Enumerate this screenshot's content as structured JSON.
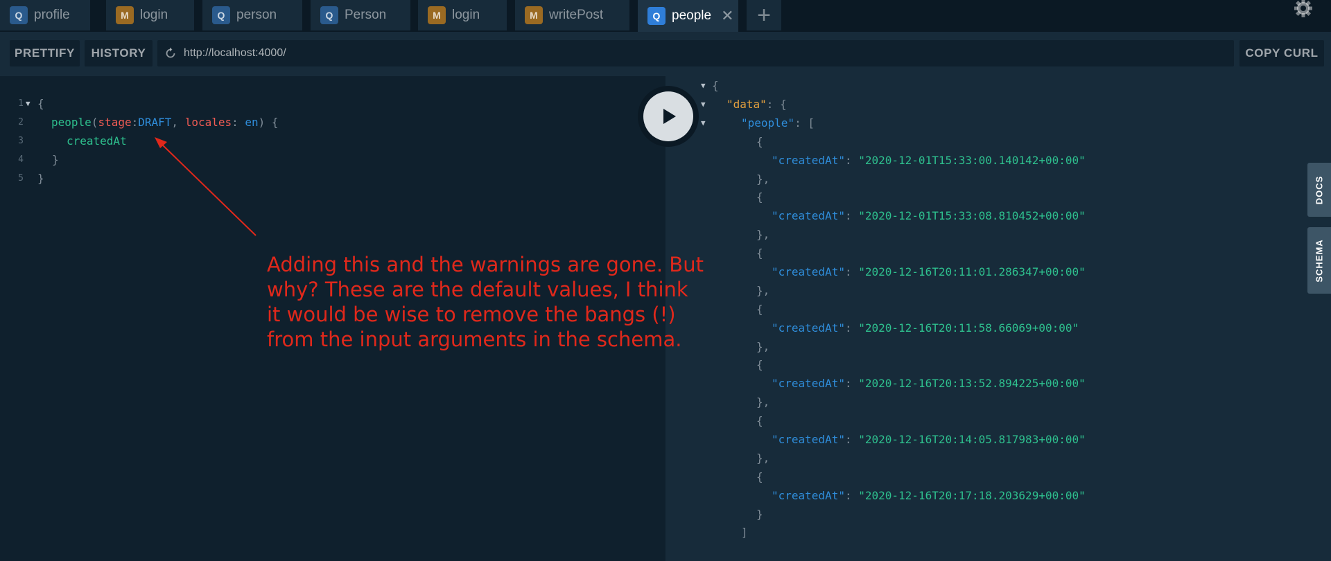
{
  "tabs": [
    {
      "badge": "Q",
      "label": "profile"
    },
    {
      "badge": "M",
      "label": "login"
    },
    {
      "badge": "Q",
      "label": "person"
    },
    {
      "badge": "Q",
      "label": "Person"
    },
    {
      "badge": "M",
      "label": "login"
    },
    {
      "badge": "M",
      "label": "writePost"
    },
    {
      "badge": "Q",
      "label": "people",
      "active": true
    }
  ],
  "toolbar": {
    "prettify_label": "PRETTIFY",
    "history_label": "HISTORY",
    "url": "http://localhost:4000/",
    "copy_curl_label": "COPY CURL"
  },
  "editor": {
    "line_numbers": [
      "1",
      "2",
      "3",
      "4",
      "5"
    ],
    "query": {
      "open_brace": "{",
      "field": "people",
      "paren_open": "(",
      "arg1_name": "stage",
      "colon1": ":",
      "arg1_value": "DRAFT",
      "comma": ", ",
      "arg2_name": "locales",
      "colon2": ": ",
      "arg2_value": "en",
      "paren_close_brace": ") {",
      "subfield": "createdAt",
      "inner_close": "}",
      "outer_close": "}"
    }
  },
  "result": {
    "root_open": "{",
    "data_key": "\"data\"",
    "people_key": "\"people\"",
    "item_key": "\"createdAt\"",
    "created_at_values": [
      "\"2020-12-01T15:33:00.140142+00:00\"",
      "\"2020-12-01T15:33:08.810452+00:00\"",
      "\"2020-12-16T20:11:01.286347+00:00\"",
      "\"2020-12-16T20:11:58.66069+00:00\"",
      "\"2020-12-16T20:13:52.894225+00:00\"",
      "\"2020-12-16T20:14:05.817983+00:00\"",
      "\"2020-12-16T20:17:18.203629+00:00\""
    ]
  },
  "side_tabs": {
    "docs": "DOCS",
    "schema": "SCHEMA"
  },
  "annotation": {
    "lines": [
      "Adding this and the warnings are gone. But",
      "why? These are the default values, I think",
      "it would be wise to remove the bangs (!)",
      "from the input arguments in the schema."
    ],
    "color": "#e0281b"
  },
  "icons": {
    "settings": "gear-icon",
    "run": "play-icon",
    "reload": "reload-icon",
    "close_tab": "close-icon",
    "new_tab": "plus-icon"
  }
}
